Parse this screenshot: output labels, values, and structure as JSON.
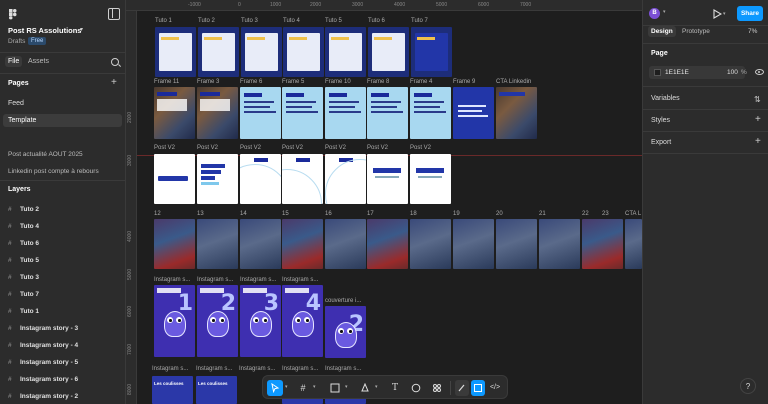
{
  "project": {
    "name": "Post RS Assolutions",
    "location": "Drafts",
    "plan": "Free"
  },
  "left_tabs": {
    "file": "File",
    "assets": "Assets"
  },
  "pages": {
    "header": "Pages",
    "items": [
      {
        "label": "Feed",
        "active": false
      },
      {
        "label": "Template",
        "active": true
      }
    ],
    "other": [
      "Post actualité AOUT 2025",
      "Linkedin post compte à rebours"
    ]
  },
  "layers": {
    "header": "Layers",
    "items": [
      "Tuto 2",
      "Tuto 4",
      "Tuto 6",
      "Tuto 5",
      "Tuto 3",
      "Tuto 7",
      "Tuto 1",
      "Instagram story - 3",
      "Instagram story - 4",
      "Instagram story - 5",
      "Instagram story - 6",
      "Instagram story - 2"
    ]
  },
  "right_panel": {
    "avatar": "B",
    "tabs": {
      "design": "Design",
      "prototype": "Prototype"
    },
    "zoom": "7%",
    "share": "Share",
    "page_section": "Page",
    "bg_color": "1E1E1E",
    "bg_opacity": "100",
    "bg_pct": "%",
    "sections": [
      "Variables",
      "Styles",
      "Export"
    ],
    "help": "?"
  },
  "rulers": {
    "top": [
      "-1000",
      "0",
      "1000",
      "2000",
      "3000",
      "4000",
      "5000",
      "6000",
      "7000"
    ],
    "left": [
      "2000",
      "3000",
      "4000",
      "5000",
      "6000",
      "7000",
      "8000"
    ]
  },
  "canvas": {
    "row1_labels": [
      "Tuto 1",
      "Tuto 2",
      "Tuto 3",
      "Tuto 4",
      "Tuto 5",
      "Tuto 6",
      "Tuto 7"
    ],
    "row2_labels": [
      "Frame 11",
      "Frame 3",
      "Frame 6",
      "Frame 5",
      "Frame 10",
      "Frame 8",
      "Frame 4",
      "Frame 9",
      "CTA Linkedin"
    ],
    "row3_labels": [
      "Post V2",
      "Post V2",
      "Post V2",
      "Post V2",
      "Post V2",
      "Post V2",
      "Post V2"
    ],
    "row4_labels": [
      "12",
      "13",
      "14",
      "15",
      "16",
      "17",
      "18",
      "19",
      "20",
      "21",
      "22",
      "23",
      "CTA L"
    ],
    "row5_labels": [
      "Instagram s...",
      "Instagram s...",
      "Instagram s...",
      "Instagram s...",
      "couverture i..."
    ],
    "row6_labels": [
      "Instagram s...",
      "Instagram s...",
      "Instagram s...",
      "Instagram s...",
      "Instagram s..."
    ],
    "mascot_numbers": [
      "1",
      "2",
      "3",
      "4",
      "2"
    ],
    "bottom_labels": [
      "Les coulisses",
      "Les coulisses"
    ]
  },
  "toolbar": {
    "tools": [
      "move-tool",
      "frame-tool",
      "shape-tool",
      "pen-tool",
      "text-tool",
      "comment-tool",
      "actions-tool",
      "draw-mode",
      "design-mode",
      "dev-mode"
    ],
    "text_glyph": "T"
  }
}
